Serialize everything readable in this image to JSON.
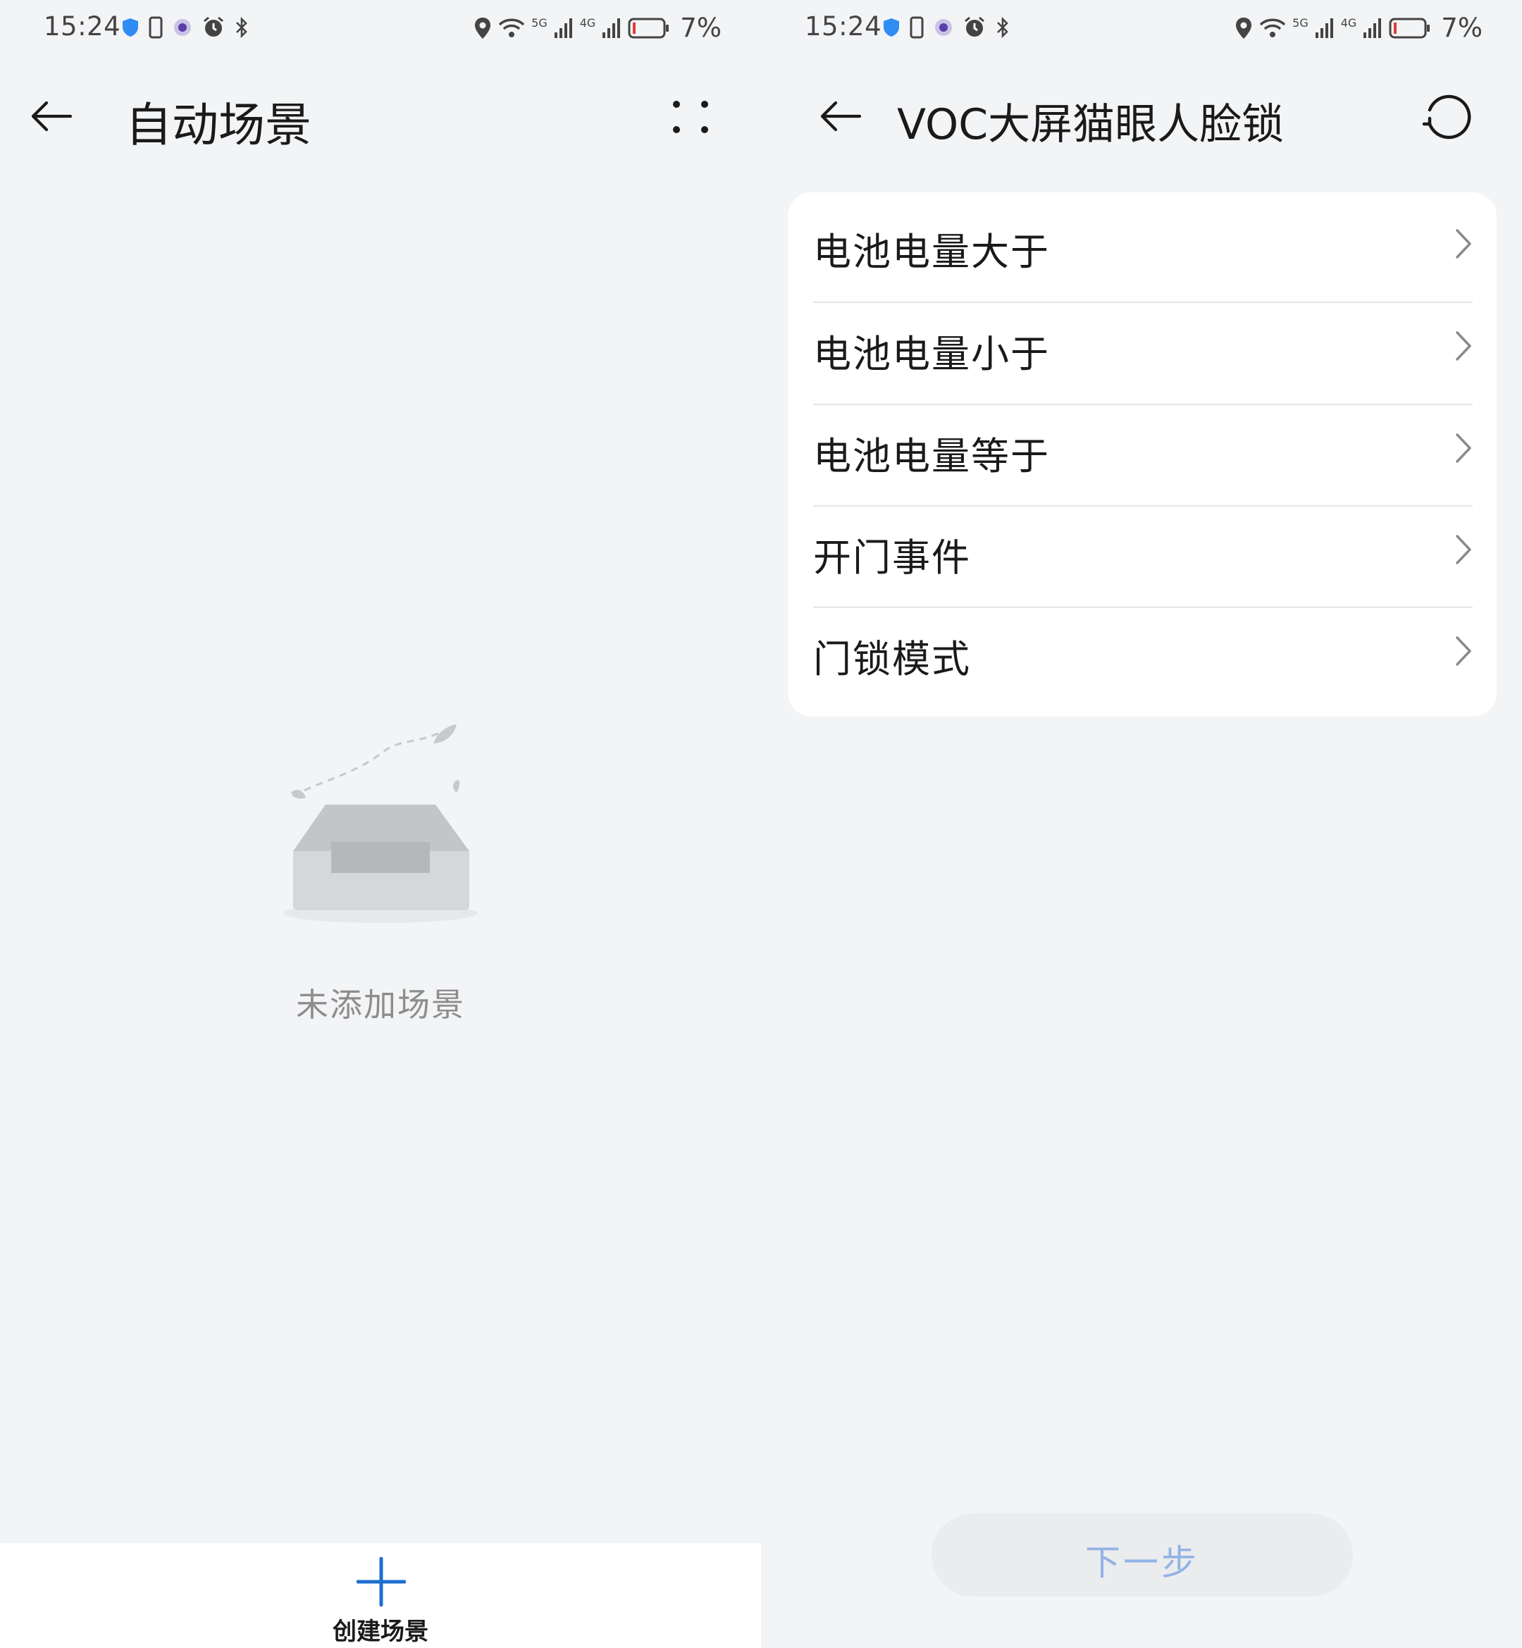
{
  "status_bar": {
    "time": "15:24",
    "battery_percent": "7%",
    "network_5g": "5G",
    "network_4g": "4G",
    "battery_color": "#e53935"
  },
  "left_screen": {
    "title": "自动场景",
    "empty_text": "未添加场景",
    "create_button_label": "创建场景",
    "accent_color": "#1e6fd0"
  },
  "right_screen": {
    "title": "VOC大屏猫眼人脸锁",
    "items": [
      {
        "label": "电池电量大于"
      },
      {
        "label": "电池电量小于"
      },
      {
        "label": "电池电量等于"
      },
      {
        "label": "开门事件"
      },
      {
        "label": "门锁模式"
      }
    ],
    "next_button_label": "下一步"
  }
}
